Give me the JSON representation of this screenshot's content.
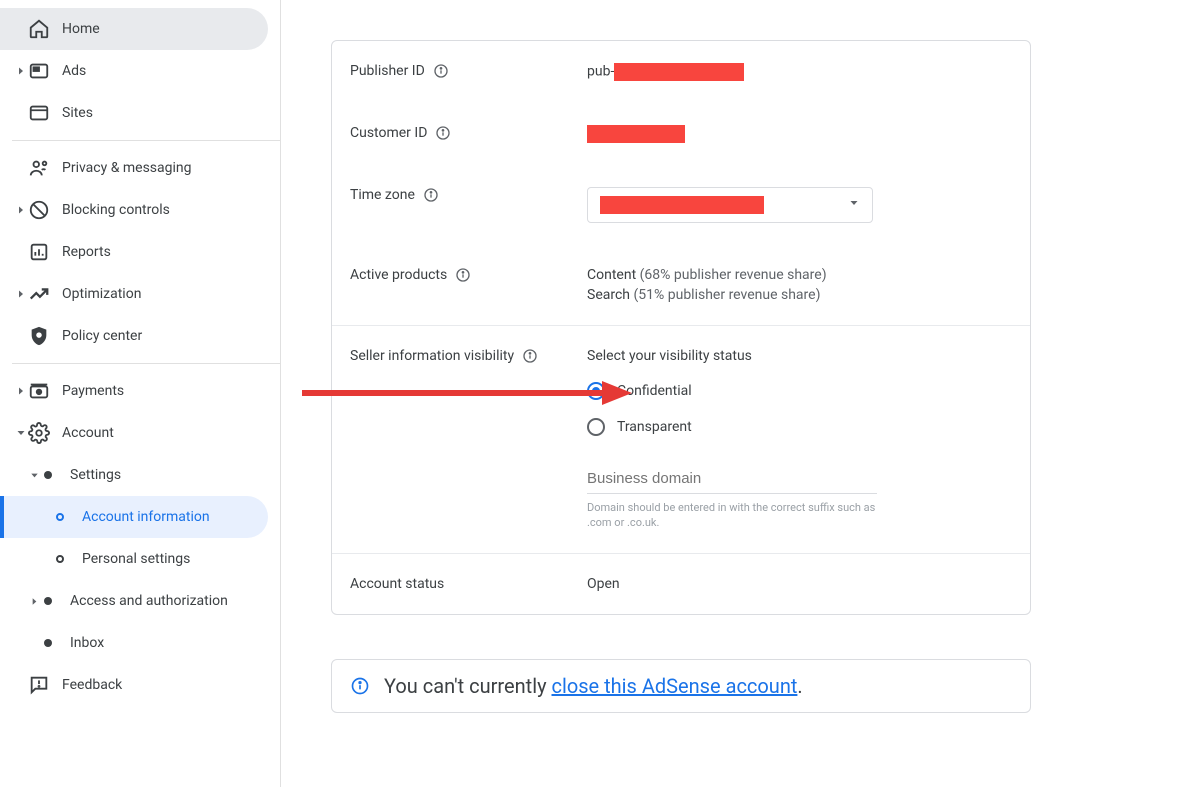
{
  "sidebar": {
    "home": "Home",
    "ads": "Ads",
    "sites": "Sites",
    "privacy": "Privacy & messaging",
    "blocking": "Blocking controls",
    "reports": "Reports",
    "optimization": "Optimization",
    "policy": "Policy center",
    "payments": "Payments",
    "account": "Account",
    "settings": "Settings",
    "account_info": "Account information",
    "personal_settings": "Personal settings",
    "access": "Access and authorization",
    "inbox": "Inbox",
    "feedback": "Feedback"
  },
  "main": {
    "publisher_id_label": "Publisher ID",
    "publisher_id_prefix": "pub-",
    "customer_id_label": "Customer ID",
    "timezone_label": "Time zone",
    "active_products_label": "Active products",
    "active_products_content": "Content ",
    "active_products_content_share": "(68% publisher revenue share)",
    "active_products_search": "Search ",
    "active_products_search_share": "(51% publisher revenue share)",
    "seller_visibility_label": "Seller information visibility",
    "seller_visibility_prompt": "Select your visibility status",
    "radio_confidential": "Confidential",
    "radio_transparent": "Transparent",
    "business_domain_placeholder": "Business domain",
    "business_domain_hint": "Domain should be entered in with the correct suffix such as .com or .co.uk.",
    "account_status_label": "Account status",
    "account_status_value": "Open",
    "banner_prefix": "You can't currently ",
    "banner_link": "close this AdSense account",
    "banner_suffix": "."
  }
}
